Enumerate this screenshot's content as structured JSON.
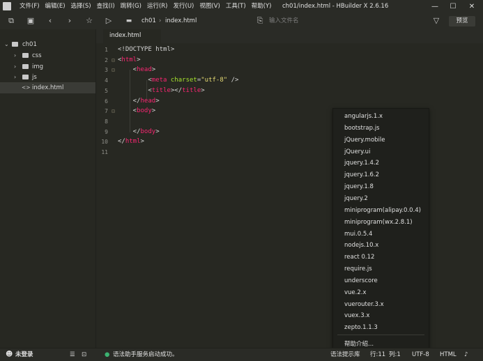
{
  "menu": [
    "文件(F)",
    "编辑(E)",
    "选择(S)",
    "查找(I)",
    "跳转(G)",
    "运行(R)",
    "发行(U)",
    "视图(V)",
    "工具(T)",
    "帮助(Y)"
  ],
  "window_title": "ch01/index.html - HBuilder X 2.6.16",
  "toolbar": {
    "breadcrumb": [
      "ch01",
      "index.html"
    ],
    "breadcrumb_sep": "›",
    "search_placeholder": "输入文件名",
    "preview_label": "预览"
  },
  "tree": {
    "project": "ch01",
    "items": [
      {
        "label": "css",
        "type": "folder"
      },
      {
        "label": "img",
        "type": "folder"
      },
      {
        "label": "js",
        "type": "folder"
      },
      {
        "label": "index.html",
        "type": "file",
        "selected": true
      }
    ]
  },
  "editor": {
    "tab": "index.html",
    "lines": [
      {
        "n": "1",
        "fold": "",
        "code": [
          [
            "g",
            "<!DOCTYPE html>"
          ]
        ]
      },
      {
        "n": "2",
        "fold": "⊟",
        "code": [
          [
            "g",
            "<"
          ],
          [
            "t",
            "html"
          ],
          [
            "g",
            ">"
          ]
        ]
      },
      {
        "n": "3",
        "fold": "⊟",
        "code": [
          [
            "g",
            "    <"
          ],
          [
            "t",
            "head"
          ],
          [
            "g",
            ">"
          ]
        ]
      },
      {
        "n": "4",
        "fold": "",
        "code": [
          [
            "g",
            "        <"
          ],
          [
            "t",
            "meta"
          ],
          [
            "g",
            " "
          ],
          [
            "a",
            "charset"
          ],
          [
            "g",
            "="
          ],
          [
            "s",
            "\"utf-8\""
          ],
          [
            "g",
            " />"
          ]
        ]
      },
      {
        "n": "5",
        "fold": "",
        "code": [
          [
            "g",
            "        <"
          ],
          [
            "t",
            "title"
          ],
          [
            "g",
            "></"
          ],
          [
            "t",
            "title"
          ],
          [
            "g",
            ">"
          ]
        ]
      },
      {
        "n": "6",
        "fold": "",
        "code": [
          [
            "g",
            "    </"
          ],
          [
            "t",
            "head"
          ],
          [
            "g",
            ">"
          ]
        ]
      },
      {
        "n": "7",
        "fold": "⊟",
        "code": [
          [
            "g",
            "    <"
          ],
          [
            "t",
            "body"
          ],
          [
            "g",
            ">"
          ]
        ]
      },
      {
        "n": "8",
        "fold": "",
        "code": []
      },
      {
        "n": "9",
        "fold": "",
        "code": [
          [
            "g",
            "    </"
          ],
          [
            "t",
            "body"
          ],
          [
            "g",
            ">"
          ]
        ]
      },
      {
        "n": "10",
        "fold": "",
        "code": [
          [
            "g",
            "</"
          ],
          [
            "t",
            "html"
          ],
          [
            "g",
            ">"
          ]
        ]
      },
      {
        "n": "11",
        "fold": "",
        "code": []
      }
    ]
  },
  "popup": {
    "items": [
      "angularjs.1.x",
      "bootstrap.js",
      "jQuery.mobile",
      "jQuery.ui",
      "jquery.1.4.2",
      "jquery.1.6.2",
      "jquery.1.8",
      "jquery.2",
      "miniprogram(alipay.0.0.4)",
      "miniprogram(wx.2.8.1)",
      "mui.0.5.4",
      "nodejs.10.x",
      "react 0.12",
      "require.js",
      "underscore",
      "vue.2.x",
      "vuerouter.3.x",
      "vuex.3.x",
      "zepto.1.1.3"
    ],
    "footer": "帮助介绍..."
  },
  "status": {
    "login": "未登录",
    "message": "语法助手服务启动成功。",
    "hint_lib": "语法提示库",
    "line_label": "行:11",
    "col_label": "列:1",
    "encoding": "UTF-8",
    "language": "HTML"
  },
  "colors": {
    "tag": "#f92672",
    "attr": "#a6e22e",
    "string": "#e6db74",
    "bg": "#272822"
  }
}
